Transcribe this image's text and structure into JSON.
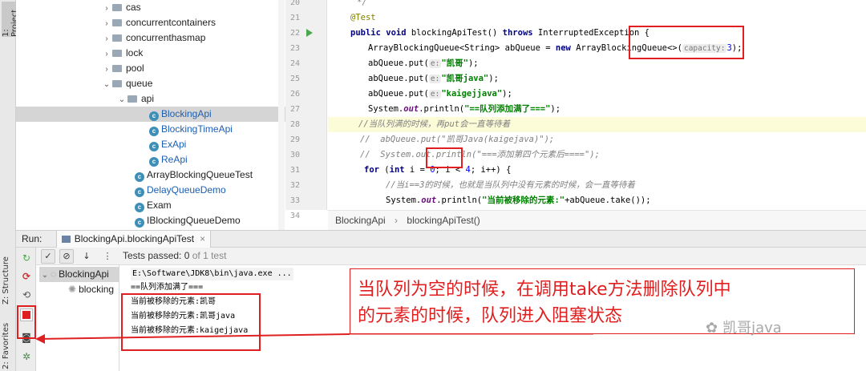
{
  "side_tabs": {
    "project": "1: Project",
    "structure": "Z: Structure",
    "favorites": "2: Favorites"
  },
  "project_tree": [
    {
      "label": "cas",
      "kind": "folder",
      "expanded": false
    },
    {
      "label": "concurrentcontainers",
      "kind": "folder",
      "expanded": false
    },
    {
      "label": "concurrenthasmap",
      "kind": "folder",
      "expanded": false
    },
    {
      "label": "lock",
      "kind": "folder",
      "expanded": false
    },
    {
      "label": "pool",
      "kind": "folder",
      "expanded": false
    },
    {
      "label": "queue",
      "kind": "folder",
      "expanded": true
    },
    {
      "label": "api",
      "kind": "folder",
      "expanded": true
    },
    {
      "label": "BlockingApi",
      "kind": "class",
      "selected": true
    },
    {
      "label": "BlockingTimeApi",
      "kind": "class"
    },
    {
      "label": "ExApi",
      "kind": "class"
    },
    {
      "label": "ReApi",
      "kind": "class"
    },
    {
      "label": "ArrayBlockingQueueTest",
      "kind": "class"
    },
    {
      "label": "DelayQueueDemo",
      "kind": "class"
    },
    {
      "label": "Exam",
      "kind": "class"
    },
    {
      "label": "IBlockingQueueDemo",
      "kind": "class"
    }
  ],
  "line_numbers": [
    "20",
    "21",
    "22",
    "23",
    "24",
    "25",
    "26",
    "27",
    "28",
    "29",
    "30",
    "31",
    "32",
    "33",
    "34"
  ],
  "code_text": {
    "l20": "*/",
    "l21": "@Test",
    "l22_a": "public void ",
    "l22_b": "blockingApiTest() ",
    "l22_c": "throws ",
    "l22_d": "InterruptedException {",
    "l23_a": "ArrayBlockingQueue<String> abQueue = ",
    "l23_b": "new ",
    "l23_c": "ArrayBlockingQueue<>(",
    "l23_hint": "capacity:",
    "l23_num": "3",
    "l23_end": ");",
    "l24_a": "abQueue.put(",
    "l24_hint": "e:",
    "l24_str": "\"凯哥\"",
    "l24_end": ");",
    "l25_a": "abQueue.put(",
    "l25_hint": "e:",
    "l25_str": "\"凯哥java\"",
    "l25_end": ");",
    "l26_a": "abQueue.put(",
    "l26_hint": "e:",
    "l26_str": "\"kaigejjava\"",
    "l26_end": ");",
    "l27_a": "System.",
    "l27_fld": "out",
    "l27_b": ".println(",
    "l27_str": "\"==队列添加满了===\"",
    "l27_end": ");",
    "l28": "//当队列满的时候，再put会一直等待着",
    "l29": "//  abQueue.put(\"凯哥Java(kaigejava)\");",
    "l30": "//  System.out.println(\"===添加第四个元素后====\");",
    "l31_kw": "for ",
    "l31_a": "(",
    "l31_kw2": "int ",
    "l31_b": "i = ",
    "l31_n0": "0",
    "l31_c": "; i < ",
    "l31_n4": "4",
    "l31_d": "; i++) {",
    "l32": "//当i==3的时候，也就是当队列中没有元素的时候，会一直等待着",
    "l33_a": "System.",
    "l33_fld": "out",
    "l33_b": ".println(",
    "l33_str": "\"当前被移除的元素:\"",
    "l33_end": "+abQueue.take());",
    "l34": "}"
  },
  "breadcrumb": {
    "class": "BlockingApi",
    "sep": "›",
    "method": "blockingApiTest()"
  },
  "run": {
    "label": "Run:",
    "config": "BlockingApi.blockingApiTest",
    "close": "×"
  },
  "tests": {
    "status_prefix": "Tests passed: ",
    "passed": "0",
    "of_total": "of 1 test"
  },
  "test_tree": {
    "root": "BlockingApi",
    "child": "blocking"
  },
  "console": {
    "cmd": "E:\\Software\\JDK8\\bin\\java.exe ...",
    "lines": [
      "==队列添加满了===",
      "当前被移除的元素:凯哥",
      "当前被移除的元素:凯哥java",
      "当前被移除的元素:kaigejjava"
    ]
  },
  "annotation": {
    "line1": "当队列为空的时候，在调用take方法删除队列中",
    "line2": "的元素的时候，队列进入阻塞状态"
  },
  "watermark": "凯哥java",
  "colors": {
    "accent_red": "#e02020",
    "class_icon": "#3d8fb8",
    "keyword": "#000080",
    "string": "#008000"
  }
}
